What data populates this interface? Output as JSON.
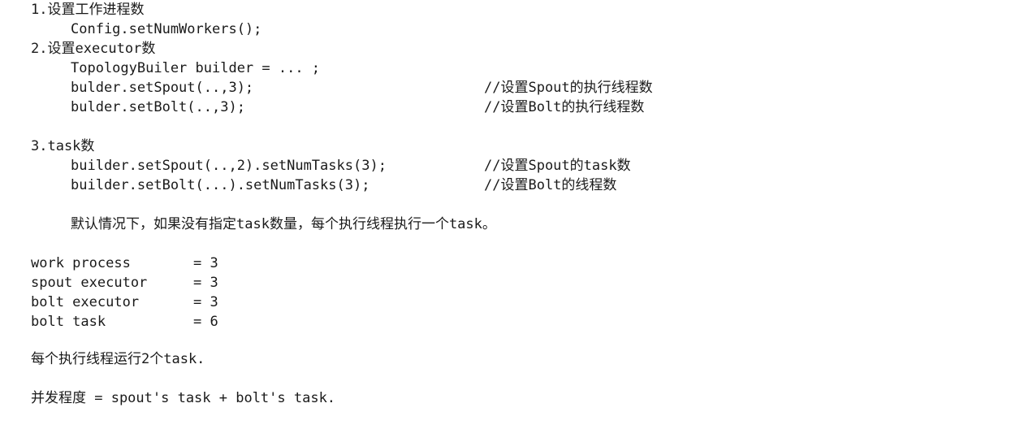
{
  "sections": {
    "s1": {
      "heading": "1.设置工作进程数",
      "code": "Config.setNumWorkers();"
    },
    "s2": {
      "heading": "2.设置executor数",
      "code": [
        {
          "code": "TopologyBuiler builder = ... ;",
          "comment": ""
        },
        {
          "code": "bulder.setSpout(..,3);",
          "comment": "//设置Spout的执行线程数"
        },
        {
          "code": "bulder.setBolt(..,3);",
          "comment": "//设置Bolt的执行线程数"
        }
      ]
    },
    "s3": {
      "heading": "3.task数",
      "code": [
        {
          "code": "builder.setSpout(..,2).setNumTasks(3);",
          "comment": "//设置Spout的task数"
        },
        {
          "code": "builder.setBolt(...).setNumTasks(3);",
          "comment": "//设置Bolt的线程数"
        }
      ],
      "note": "默认情况下，如果没有指定task数量，每个执行线程执行一个task。"
    }
  },
  "summary": [
    {
      "label": "work process",
      "value": "= 3"
    },
    {
      "label": "spout executor",
      "value": "= 3"
    },
    {
      "label": "bolt executor",
      "value": "= 3"
    },
    {
      "label": "bolt task",
      "value": "= 6"
    }
  ],
  "conclusion1": "每个执行线程运行2个task.",
  "conclusion2": "并发程度 = spout's task + bolt's task."
}
